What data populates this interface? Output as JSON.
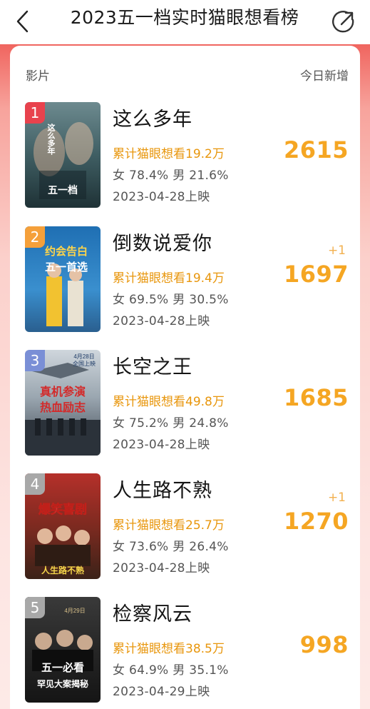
{
  "header": {
    "title": "2023五一档实时猫眼想看榜"
  },
  "table": {
    "col_film": "影片",
    "col_today": "今日新增"
  },
  "movies": [
    {
      "rank": "1",
      "name": "这么多年",
      "want_total": "累计猫眼想看19.2万",
      "gender": "女 78.4% 男 21.6%",
      "release": "2023-04-28上映",
      "delta": "",
      "today": "2615",
      "rank_color": "#e8424d"
    },
    {
      "rank": "2",
      "name": "倒数说爱你",
      "want_total": "累计猫眼想看19.4万",
      "gender": "女 69.5% 男 30.5%",
      "release": "2023-04-28上映",
      "delta": "+1",
      "today": "1697",
      "rank_color": "#f5a03a"
    },
    {
      "rank": "3",
      "name": "长空之王",
      "want_total": "累计猫眼想看49.8万",
      "gender": "女 75.2% 男 24.8%",
      "release": "2023-04-28上映",
      "delta": "",
      "today": "1685",
      "rank_color": "#7a8fd6"
    },
    {
      "rank": "4",
      "name": "人生路不熟",
      "want_total": "累计猫眼想看25.7万",
      "gender": "女 73.6% 男 26.4%",
      "release": "2023-04-28上映",
      "delta": "+1",
      "today": "1270",
      "rank_color": "#a8a8a8"
    },
    {
      "rank": "5",
      "name": "检察风云",
      "want_total": "累计猫眼想看38.5万",
      "gender": "女 64.9% 男 35.1%",
      "release": "2023-04-29上映",
      "delta": "",
      "today": "998",
      "rank_color": "#a8a8a8"
    }
  ],
  "posters": [
    {
      "caption": "这么多年",
      "tag": "五一档"
    },
    {
      "caption": "约会告白",
      "tag": "五一首选"
    },
    {
      "caption": "真机参演",
      "tag": "热血励志",
      "date": "4月28日",
      "sub": "全国上映"
    },
    {
      "caption": "爆笑喜剧",
      "tag": "人生路不熟"
    },
    {
      "caption": "五一必看",
      "tag": "罕见大案揭秘",
      "date": "4月29日"
    }
  ],
  "icons": {
    "back": "back-chevron-icon",
    "share": "share-arrow-icon"
  }
}
